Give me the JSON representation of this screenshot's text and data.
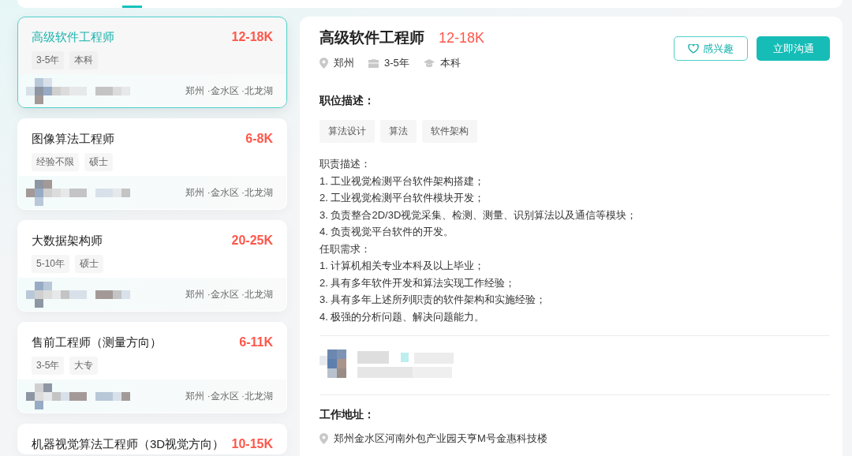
{
  "jobs": [
    {
      "title": "高级软件工程师",
      "salary": "12-18K",
      "tags": [
        "3-5年",
        "本科"
      ],
      "location": "郑州 ·金水区 ·北龙湖",
      "selected": true
    },
    {
      "title": "图像算法工程师",
      "salary": "6-8K",
      "tags": [
        "经验不限",
        "硕士"
      ],
      "location": "郑州 ·金水区 ·北龙湖",
      "selected": false
    },
    {
      "title": "大数据架构师",
      "salary": "20-25K",
      "tags": [
        "5-10年",
        "硕士"
      ],
      "location": "郑州 ·金水区 ·北龙湖",
      "selected": false
    },
    {
      "title": "售前工程师（测量方向）",
      "salary": "6-11K",
      "tags": [
        "3-5年",
        "大专"
      ],
      "location": "郑州 ·金水区 ·北龙湖",
      "selected": false
    },
    {
      "title": "机器视觉算法工程师（3D视觉方向）",
      "salary": "10-15K",
      "selected": false
    }
  ],
  "detail": {
    "title": "高级软件工程师",
    "salary": "12-18K",
    "meta": [
      {
        "kind": "location",
        "text": "郑州"
      },
      {
        "kind": "experience",
        "text": "3-5年"
      },
      {
        "kind": "education",
        "text": "本科"
      }
    ],
    "buttons": [
      {
        "kind": "interest",
        "label": "感兴趣"
      },
      {
        "kind": "chat",
        "label": "立即沟通"
      }
    ],
    "description_title": "职位描述：",
    "skill_tags": [
      "算法设计",
      "算法",
      "软件架构"
    ],
    "description": [
      "职责描述：",
      "1. 工业视觉检测平台软件架构搭建；",
      "2. 工业视觉检测平台软件模块开发；",
      "3. 负责整合2D/3D视觉采集、检测、测量、识别算法以及通信等模块；",
      "4. 负责视觉平台软件的开发。",
      "任职需求：",
      "1. 计算机相关专业本科及以上毕业；",
      "2. 具有多年软件开发和算法实现工作经验；",
      "3. 具有多年上述所列职责的软件架构和实施经验；",
      "4. 极强的分析问题、解决问题能力。"
    ],
    "address_title": "工作地址：",
    "address": "郑州金水区河南外包产业园天亨M号金惠科技楼"
  }
}
